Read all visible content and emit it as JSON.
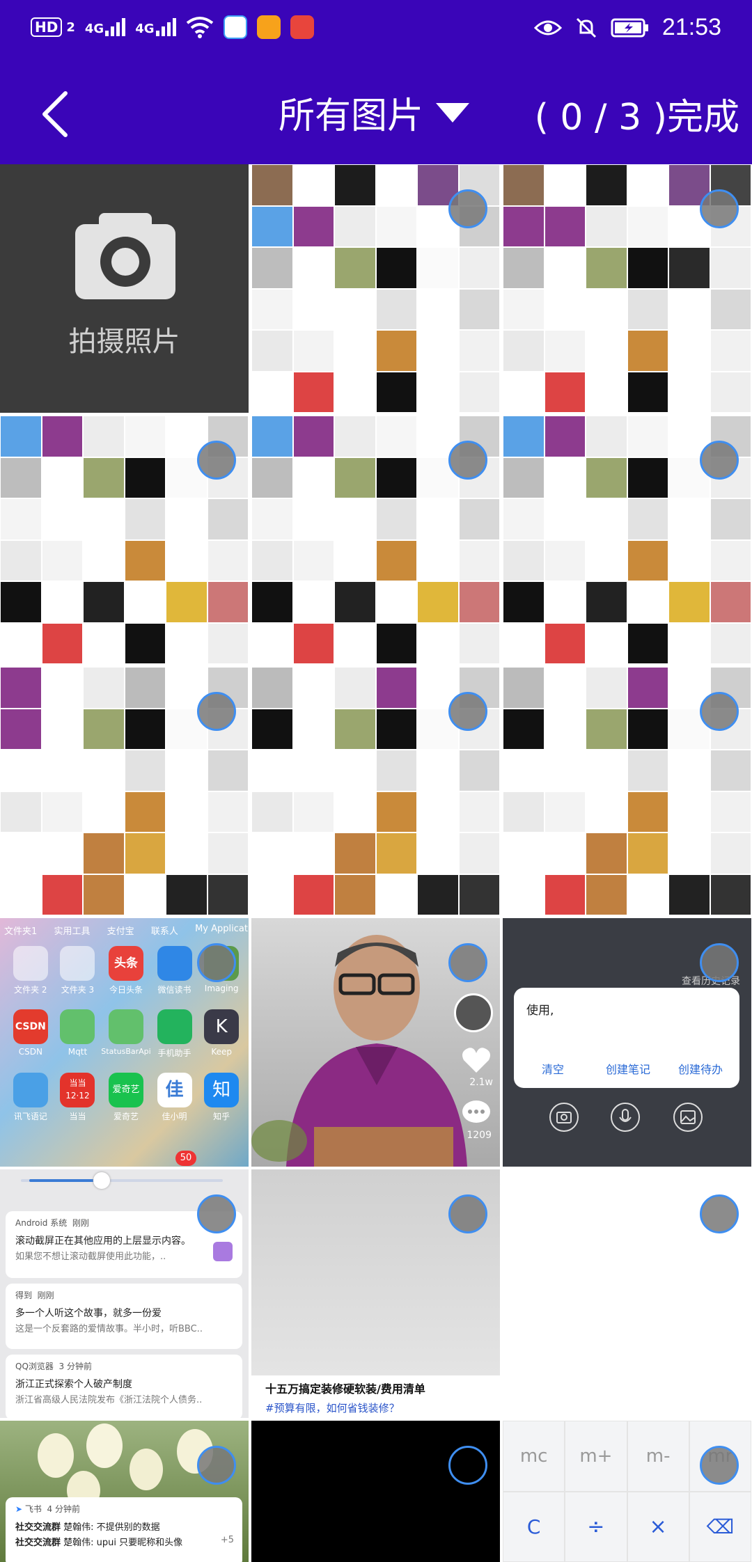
{
  "status_bar": {
    "hd_label": "HD",
    "sim1_label": "2",
    "net1": "4G",
    "net2": "4G",
    "time": "21:53"
  },
  "app_bar": {
    "title": "所有图片",
    "done_label": "( 0 / 3 )完成"
  },
  "camera_cell": {
    "label": "拍摄照片"
  },
  "cells": {
    "home_screen": {
      "top_row": [
        "文件夹1",
        "实用工具",
        "支付宝",
        "联系人",
        "My Applicat"
      ],
      "apps": [
        "文件夹 2",
        "文件夹 3",
        "今日头条",
        "微信读书",
        "Imaging",
        "CSDN",
        "Mqtt",
        "StatusBarApi",
        "手机助手",
        "Keep",
        "讯飞语记",
        "当当",
        "爱奇艺",
        "佳小明",
        "知乎"
      ],
      "toutiao_text": "头条",
      "csdn_text": "CSDN",
      "dd_text": "当当",
      "dd_badge": "12·12",
      "iqiyi_text": "爱奇艺",
      "jia_text": "佳",
      "zhihu_text": "知",
      "keep_text": "K",
      "badge": "50"
    },
    "video": {
      "likes": "2.1w",
      "comments": "1209"
    },
    "note": {
      "history": "查看历史记录",
      "input_text": "使用,",
      "clear": "清空",
      "create_note": "创建笔记",
      "create_todo": "创建待办"
    },
    "notifications": {
      "n1_app": "Android 系统",
      "n1_time": "刚刚",
      "n1_title": "滚动截屏正在其他应用的上层显示内容。",
      "n1_body": "如果您不想让滚动截屏使用此功能，..",
      "n2_app": "得到",
      "n2_time": "刚刚",
      "n2_title": "多一个人听这个故事，就多一份爱",
      "n2_body": "这是一个反套路的爱情故事。半小时，听BBC..",
      "n3_app": "QQ浏览器",
      "n3_time": "3 分钟前",
      "n3_title": "浙江正式探索个人破产制度",
      "n3_body": "浙江省高级人民法院发布《浙江法院个人债务.."
    },
    "article": {
      "title": "十五万搞定装修硬软装/费用清单",
      "tag": "#预算有限，如何省钱装修？"
    },
    "feishu": {
      "app": "飞书",
      "time": "4 分钟前",
      "l1_group": "社交交流群",
      "l1_text": "楚翰伟: 不提供别的数据",
      "l2_group": "社交交流群",
      "l2_text": "楚翰伟: upui 只要昵称和头像",
      "count": "+5"
    },
    "calculator": {
      "keys_row1": [
        "mc",
        "m+",
        "m-",
        "mr"
      ],
      "keys_row2": [
        "C",
        "÷",
        "×",
        "⌫"
      ]
    }
  },
  "colors": {
    "bar": "#3a05b8",
    "select_ring": "#3f8ef0",
    "camera_bg": "#3b3b3b"
  }
}
